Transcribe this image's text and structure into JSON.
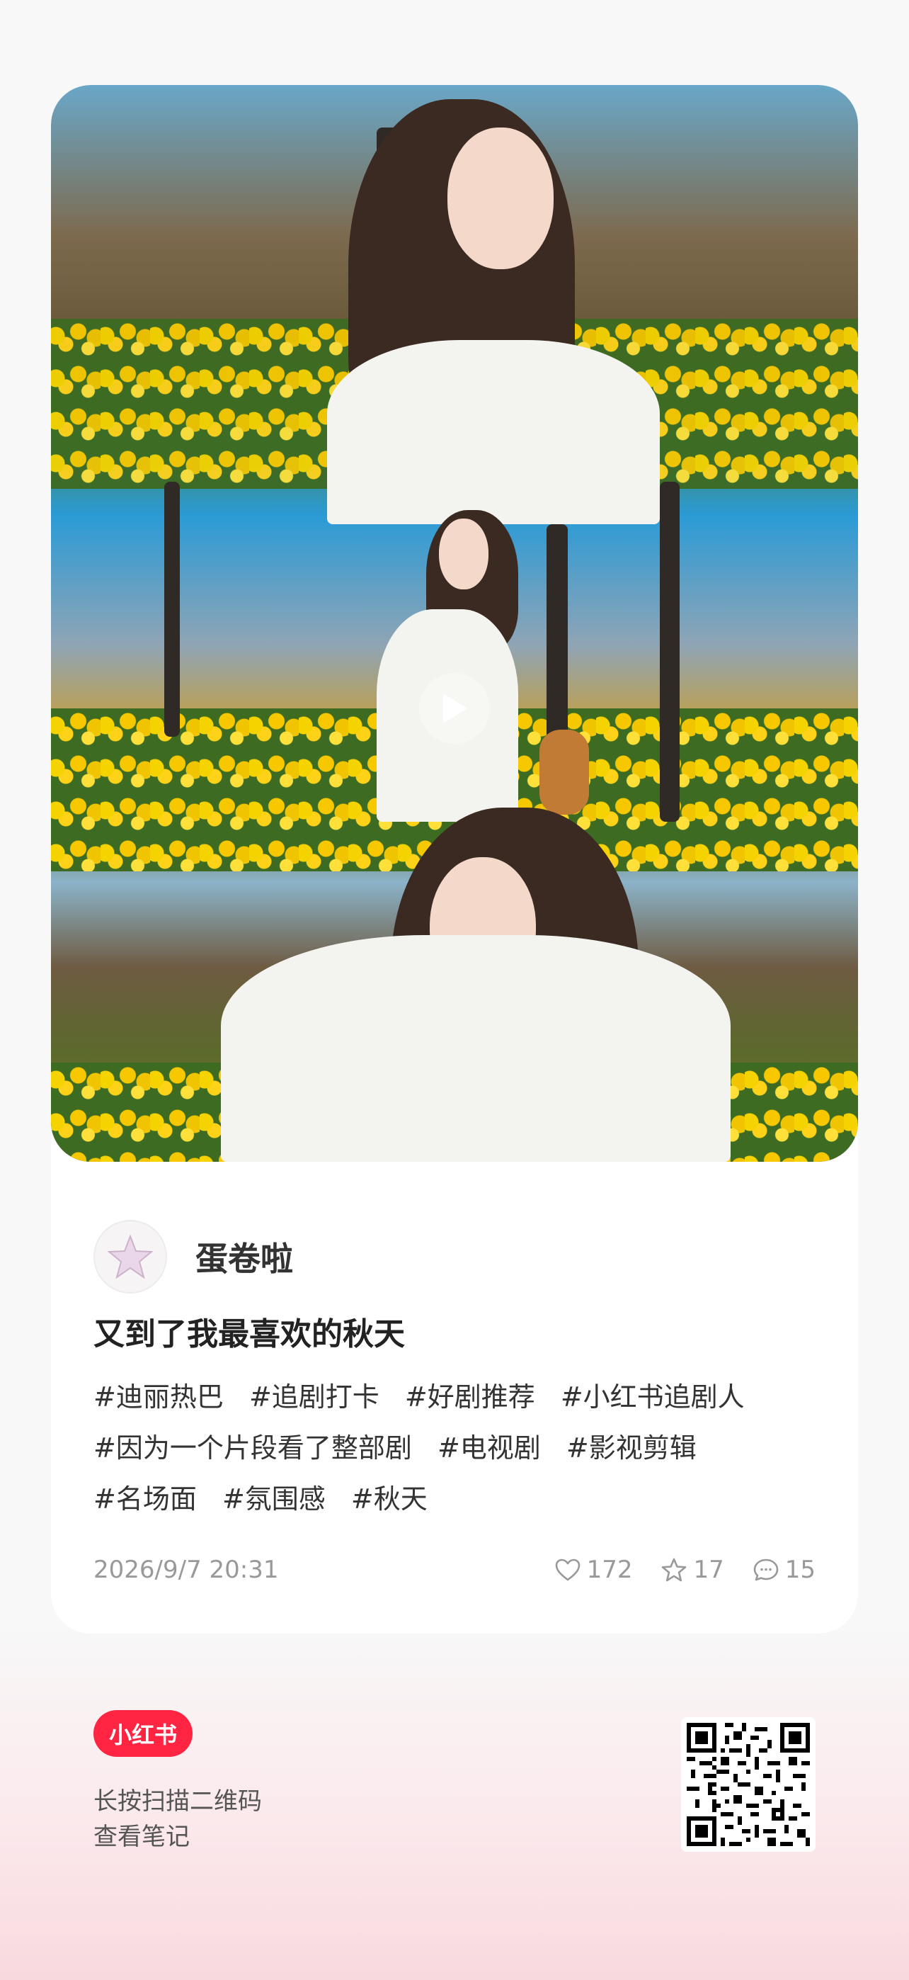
{
  "author": {
    "name": "蛋卷啦"
  },
  "note": {
    "title": "又到了我最喜欢的秋天",
    "tags": [
      "#迪丽热巴",
      "#追剧打卡",
      "#好剧推荐",
      "#小红书追剧人",
      "#因为一个片段看了整部剧",
      "#电视剧",
      "#影视剪辑",
      "#名场面",
      "#氛围感",
      "#秋天"
    ],
    "date": "2026/9/7 20:31",
    "likes": "172",
    "collects": "17",
    "comments": "15"
  },
  "footer": {
    "brand": "小红书",
    "hint_line1": "长按扫描二维码",
    "hint_line2": "查看笔记"
  },
  "colors": {
    "brand_red": "#ff2442",
    "text": "#333333",
    "muted": "#999999"
  },
  "icons": [
    "play-icon",
    "heart-icon",
    "star-icon",
    "comment-icon",
    "star-avatar-icon",
    "qr-code"
  ]
}
